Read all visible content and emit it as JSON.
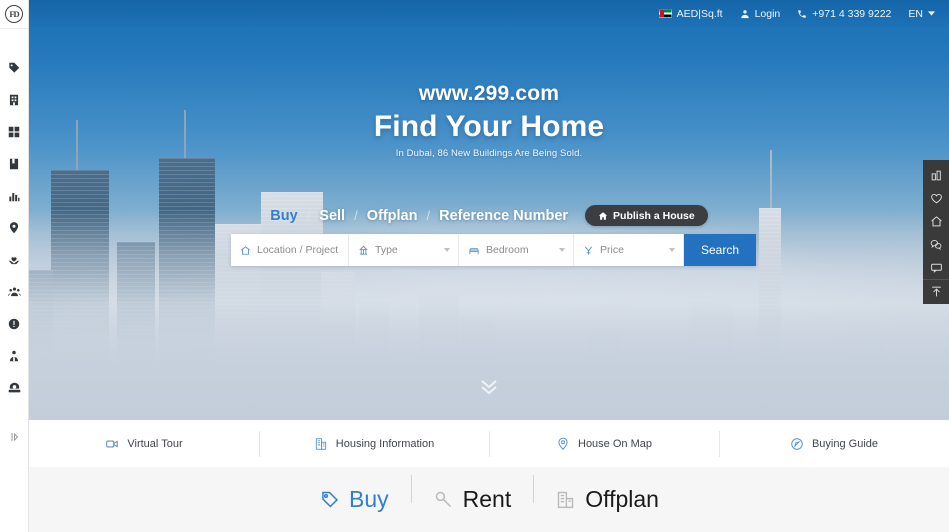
{
  "sidebar": {
    "logo_text": "FD",
    "items": [
      {
        "name": "tag",
        "label": "Listings"
      },
      {
        "name": "building",
        "label": "Buildings"
      },
      {
        "name": "grid",
        "label": "Categories"
      },
      {
        "name": "book",
        "label": "Guides"
      },
      {
        "name": "chart",
        "label": "Market Stats"
      },
      {
        "name": "pin",
        "label": "Map"
      },
      {
        "name": "heart-hands",
        "label": "Favorites"
      },
      {
        "name": "people",
        "label": "Community"
      },
      {
        "name": "info",
        "label": "Information"
      },
      {
        "name": "agent",
        "label": "Agents"
      },
      {
        "name": "phone",
        "label": "Contact"
      }
    ],
    "collapse_label": "Expand sidebar"
  },
  "topbar": {
    "currency": "AED|Sq.ft",
    "login": "Login",
    "phone": "+971 4 339 9222",
    "language": "EN",
    "flag_alt": "uae-flag"
  },
  "hero": {
    "brand_url": "www.299.com",
    "title": "Find Your Home",
    "subtitle": "In Dubai, 86 New Buildings Are Being Sold.",
    "tabs": [
      {
        "label": "Buy",
        "active": true
      },
      {
        "label": "Sell",
        "active": false
      },
      {
        "label": "Offplan",
        "active": false
      },
      {
        "label": "Reference Number",
        "active": false
      }
    ],
    "tab_separator": "/",
    "publish_button": "Publish a House",
    "scroll_hint": "scroll-down-chevron"
  },
  "search": {
    "location_placeholder": "Location / Project",
    "type_placeholder": "Type",
    "bedroom_placeholder": "Bedroom",
    "price_placeholder": "Price",
    "search_button": "Search"
  },
  "right_toolbar": {
    "items": [
      {
        "name": "compare",
        "label": "Compare"
      },
      {
        "name": "favorite",
        "label": "Favorites"
      },
      {
        "name": "home",
        "label": "Home"
      },
      {
        "name": "wechat",
        "label": "WeChat"
      },
      {
        "name": "chat",
        "label": "Message"
      },
      {
        "name": "back-to-top",
        "label": "Back to top"
      }
    ]
  },
  "features": [
    {
      "label": "Virtual Tour",
      "icon": "video-icon"
    },
    {
      "label": "Housing Information",
      "icon": "building-icon"
    },
    {
      "label": "House On Map",
      "icon": "map-pin-icon"
    },
    {
      "label": "Buying Guide",
      "icon": "compass-icon"
    }
  ],
  "bottom_tabs": [
    {
      "label": "Buy",
      "icon": "tag-icon",
      "active": true
    },
    {
      "label": "Rent",
      "icon": "key-icon",
      "active": false
    },
    {
      "label": "Offplan",
      "icon": "building-icon",
      "active": false
    }
  ],
  "colors": {
    "accent_blue": "#2471c0",
    "tab_active": "#2f80d6",
    "hero_top": "#1a6fb5",
    "dark_pill": "#3b3e40",
    "toolbar_dark": "#3a3a3a",
    "bottom_bg": "#f7f6f7"
  }
}
